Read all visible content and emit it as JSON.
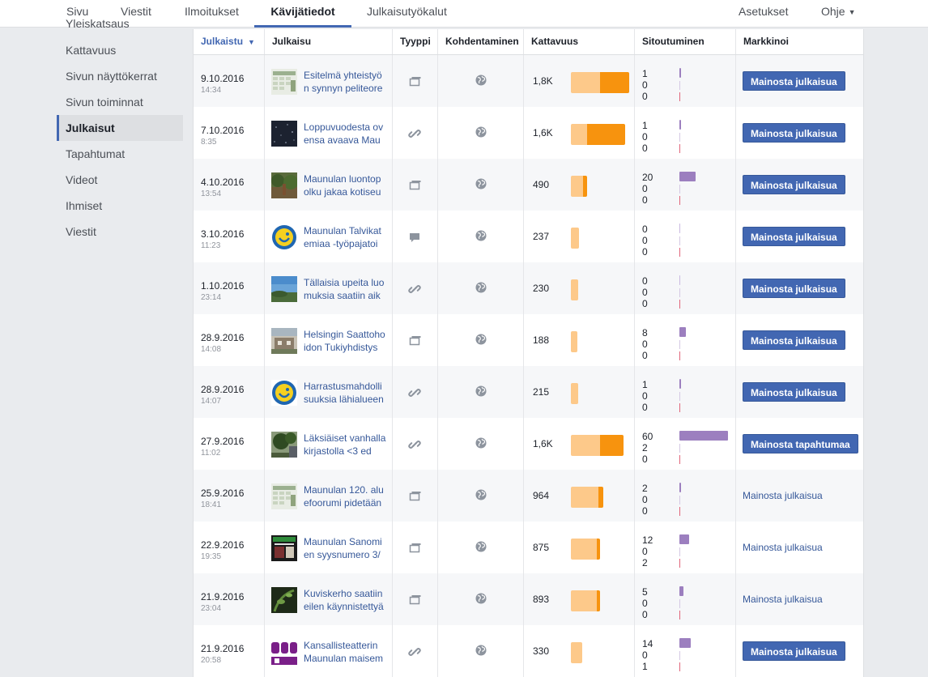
{
  "nav": {
    "tabs": [
      {
        "label": "Sivu",
        "active": false
      },
      {
        "label": "Viestit",
        "active": false
      },
      {
        "label": "Ilmoitukset",
        "active": false
      },
      {
        "label": "Kävijätiedot",
        "active": true
      },
      {
        "label": "Julkaisutyökalut",
        "active": false
      }
    ],
    "settings": "Asetukset",
    "help": "Ohje"
  },
  "sidebar": {
    "cut_item": "Yleiskatsaus",
    "items": [
      {
        "label": "Kattavuus",
        "active": false
      },
      {
        "label": "Sivun näyttökerrat",
        "active": false
      },
      {
        "label": "Sivun toiminnat",
        "active": false
      },
      {
        "label": "Julkaisut",
        "active": true
      },
      {
        "label": "Tapahtumat",
        "active": false
      },
      {
        "label": "Videot",
        "active": false
      },
      {
        "label": "Ihmiset",
        "active": false
      },
      {
        "label": "Viestit",
        "active": false
      }
    ]
  },
  "table": {
    "headers": {
      "date": "Julkaistu",
      "post": "Julkaisu",
      "type": "Tyyppi",
      "targeting": "Kohdentaminen",
      "reach": "Kattavuus",
      "engagement": "Sitoutuminen",
      "promote": "Markkinoi"
    },
    "colors": {
      "reach_organic": "#fdc98a",
      "reach_paid": "#f7930e",
      "engagement": "#9c7fbf",
      "button": "#4267b2"
    },
    "rows": [
      {
        "date": "9.10.2016",
        "time": "14:34",
        "text": "Esitelmä yhteistyön synnyn peliteore",
        "thumb": "table-img",
        "type": "post-icon",
        "reach": "1,8K",
        "reach_light": 0.5,
        "reach_dark": 0.5,
        "reach_fraction": 1.0,
        "eng": [
          "1",
          "0",
          "0"
        ],
        "eng_fraction": 0.02,
        "promote": "Mainosta julkaisua",
        "promote_style": "button"
      },
      {
        "date": "7.10.2016",
        "time": "8:35",
        "text": "Loppuvuodesta ovensa avaava Mau",
        "thumb": "night-img",
        "type": "link-icon",
        "reach": "1,6K",
        "reach_light": 0.3,
        "reach_dark": 0.7,
        "reach_fraction": 0.93,
        "eng": [
          "1",
          "0",
          "0"
        ],
        "eng_fraction": 0.02,
        "promote": "Mainosta julkaisua",
        "promote_style": "button"
      },
      {
        "date": "4.10.2016",
        "time": "13:54",
        "text": "Maunulan luontopolku jakaa kotiseu",
        "thumb": "forest-img",
        "type": "post-icon",
        "reach": "490",
        "reach_light": 0.75,
        "reach_dark": 0.25,
        "reach_fraction": 0.28,
        "eng": [
          "20",
          "0",
          "0"
        ],
        "eng_fraction": 0.33,
        "promote": "Mainosta julkaisua",
        "promote_style": "button"
      },
      {
        "date": "3.10.2016",
        "time": "11:23",
        "text": "Maunulan Talvikatemiaa -työpajatoi",
        "thumb": "logo-img",
        "type": "status-icon",
        "reach": "237",
        "reach_light": 1.0,
        "reach_dark": 0.0,
        "reach_fraction": 0.14,
        "eng": [
          "0",
          "0",
          "0"
        ],
        "eng_fraction": 0.0,
        "promote": "Mainosta julkaisua",
        "promote_style": "button"
      },
      {
        "date": "1.10.2016",
        "time": "23:14",
        "text": "Tällaisia upeita luomuksia saatiin aik",
        "thumb": "sky-img",
        "type": "link-icon",
        "reach": "230",
        "reach_light": 1.0,
        "reach_dark": 0.0,
        "reach_fraction": 0.13,
        "eng": [
          "0",
          "0",
          "0"
        ],
        "eng_fraction": 0.0,
        "promote": "Mainosta julkaisua",
        "promote_style": "button"
      },
      {
        "date": "28.9.2016",
        "time": "14:08",
        "text": "Helsingin Saattohoidon Tukiyhdistys",
        "thumb": "house-img",
        "type": "post-icon",
        "reach": "188",
        "reach_light": 1.0,
        "reach_dark": 0.0,
        "reach_fraction": 0.11,
        "eng": [
          "8",
          "0",
          "0"
        ],
        "eng_fraction": 0.13,
        "promote": "Mainosta julkaisua",
        "promote_style": "button"
      },
      {
        "date": "28.9.2016",
        "time": "14:07",
        "text": "Harrastusmahdollisuuksia lähialueen",
        "thumb": "logo-img",
        "type": "link-icon",
        "reach": "215",
        "reach_light": 1.0,
        "reach_dark": 0.0,
        "reach_fraction": 0.12,
        "eng": [
          "1",
          "0",
          "0"
        ],
        "eng_fraction": 0.02,
        "promote": "Mainosta julkaisua",
        "promote_style": "button"
      },
      {
        "date": "27.9.2016",
        "time": "11:02",
        "text": "Läksiäiset vanhalla kirjastolla <3 ed",
        "thumb": "tree-img",
        "type": "link-icon",
        "reach": "1,6K",
        "reach_light": 0.55,
        "reach_dark": 0.45,
        "reach_fraction": 0.9,
        "eng": [
          "60",
          "2",
          "0"
        ],
        "eng_fraction": 1.0,
        "promote": "Mainosta tapahtumaa",
        "promote_style": "button"
      },
      {
        "date": "25.9.2016",
        "time": "18:41",
        "text": "Maunulan 120. aluefoorumi pidetään",
        "thumb": "table-img",
        "type": "post-icon",
        "reach": "964",
        "reach_light": 0.85,
        "reach_dark": 0.15,
        "reach_fraction": 0.55,
        "eng": [
          "2",
          "0",
          "0"
        ],
        "eng_fraction": 0.03,
        "promote": "Mainosta julkaisua",
        "promote_style": "link"
      },
      {
        "date": "22.9.2016",
        "time": "19:35",
        "text": "Maunulan Sanomien syysnumero 3/",
        "thumb": "newspaper-img",
        "type": "post-icon",
        "reach": "875",
        "reach_light": 0.9,
        "reach_dark": 0.1,
        "reach_fraction": 0.5,
        "eng": [
          "12",
          "0",
          "2"
        ],
        "eng_fraction": 0.2,
        "promote": "Mainosta julkaisua",
        "promote_style": "link"
      },
      {
        "date": "21.9.2016",
        "time": "23:04",
        "text": "Kuviskerho saatiin eilen käynnistettyä",
        "thumb": "plant-img",
        "type": "post-icon",
        "reach": "893",
        "reach_light": 0.88,
        "reach_dark": 0.12,
        "reach_fraction": 0.5,
        "eng": [
          "5",
          "0",
          "0"
        ],
        "eng_fraction": 0.08,
        "promote": "Mainosta julkaisua",
        "promote_style": "link"
      },
      {
        "date": "21.9.2016",
        "time": "20:58",
        "text": "Kansallisteatterin Maunulan maisem",
        "thumb": "purple-img",
        "type": "link-icon",
        "reach": "330",
        "reach_light": 1.0,
        "reach_dark": 0.0,
        "reach_fraction": 0.19,
        "eng": [
          "14",
          "0",
          "1"
        ],
        "eng_fraction": 0.23,
        "promote": "Mainosta julkaisua",
        "promote_style": "button"
      }
    ]
  }
}
